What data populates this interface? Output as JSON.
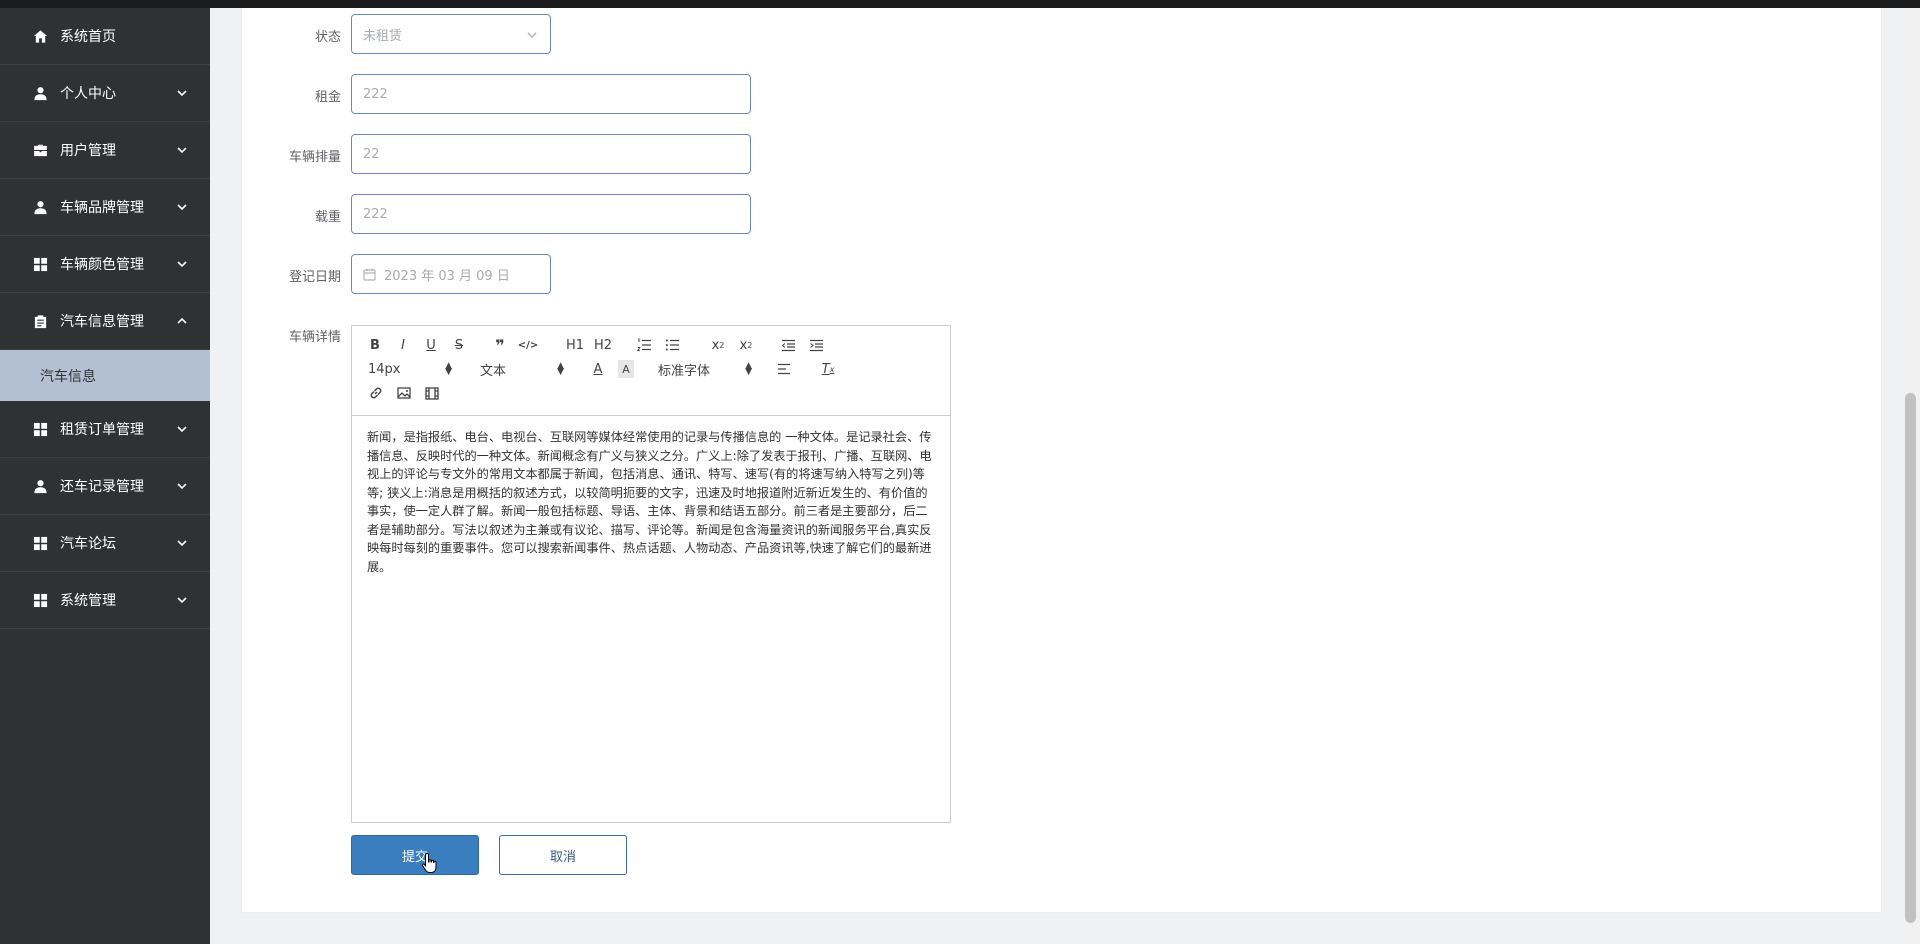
{
  "sidebar": {
    "items": [
      {
        "label": "系统首页",
        "icon": "home-icon",
        "expandable": false
      },
      {
        "label": "个人中心",
        "icon": "user-icon",
        "expandable": true
      },
      {
        "label": "用户管理",
        "icon": "briefcase-icon",
        "expandable": true
      },
      {
        "label": "车辆品牌管理",
        "icon": "user-icon",
        "expandable": true
      },
      {
        "label": "车辆颜色管理",
        "icon": "grid-icon",
        "expandable": true
      },
      {
        "label": "汽车信息管理",
        "icon": "clipboard-icon",
        "expandable": true,
        "expanded": true
      },
      {
        "label": "租赁订单管理",
        "icon": "grid-icon",
        "expandable": true
      },
      {
        "label": "还车记录管理",
        "icon": "user-icon",
        "expandable": true
      },
      {
        "label": "汽车论坛",
        "icon": "grid-icon",
        "expandable": true
      },
      {
        "label": "系统管理",
        "icon": "grid-icon",
        "expandable": true
      }
    ],
    "sub_item": "汽车信息"
  },
  "form": {
    "status_label": "状态",
    "status_value": "未租赁",
    "rent_label": "租金",
    "rent_value": "222",
    "displacement_label": "车辆排量",
    "displacement_value": "22",
    "load_label": "载重",
    "load_value": "222",
    "date_label": "登记日期",
    "date_value": "2023 年 03 月 09 日",
    "detail_label": "车辆详情"
  },
  "editor": {
    "font_size": "14px",
    "text_type": "文本",
    "font_family": "标准字体",
    "h1": "H1",
    "h2": "H2",
    "content": "新闻，是指报纸、电台、电视台、互联网等媒体经常使用的记录与传播信息的 一种文体。是记录社会、传播信息、反映时代的一种文体。新闻概念有广义与狭义之分。广义上:除了发表于报刊、广播、互联网、电视上的评论与专文外的常用文本都属于新闻，包括消息、通讯、特写、速写(有的将速写纳入特写之列)等等; 狭义上:消息是用概括的叙述方式，以较简明扼要的文字，迅速及时地报道附近新近发生的、有价值的事实，使一定人群了解。新闻一般包括标题、导语、主体、背景和结语五部分。前三者是主要部分，后二者是辅助部分。写法以叙述为主兼或有议论、描写、评论等。新闻是包含海量资讯的新闻服务平台,真实反映每时每刻的重要事件。您可以搜索新闻事件、热点话题、人物动态、产品资讯等,快速了解它们的最新进展。"
  },
  "buttons": {
    "submit": "提交",
    "cancel": "取消"
  }
}
